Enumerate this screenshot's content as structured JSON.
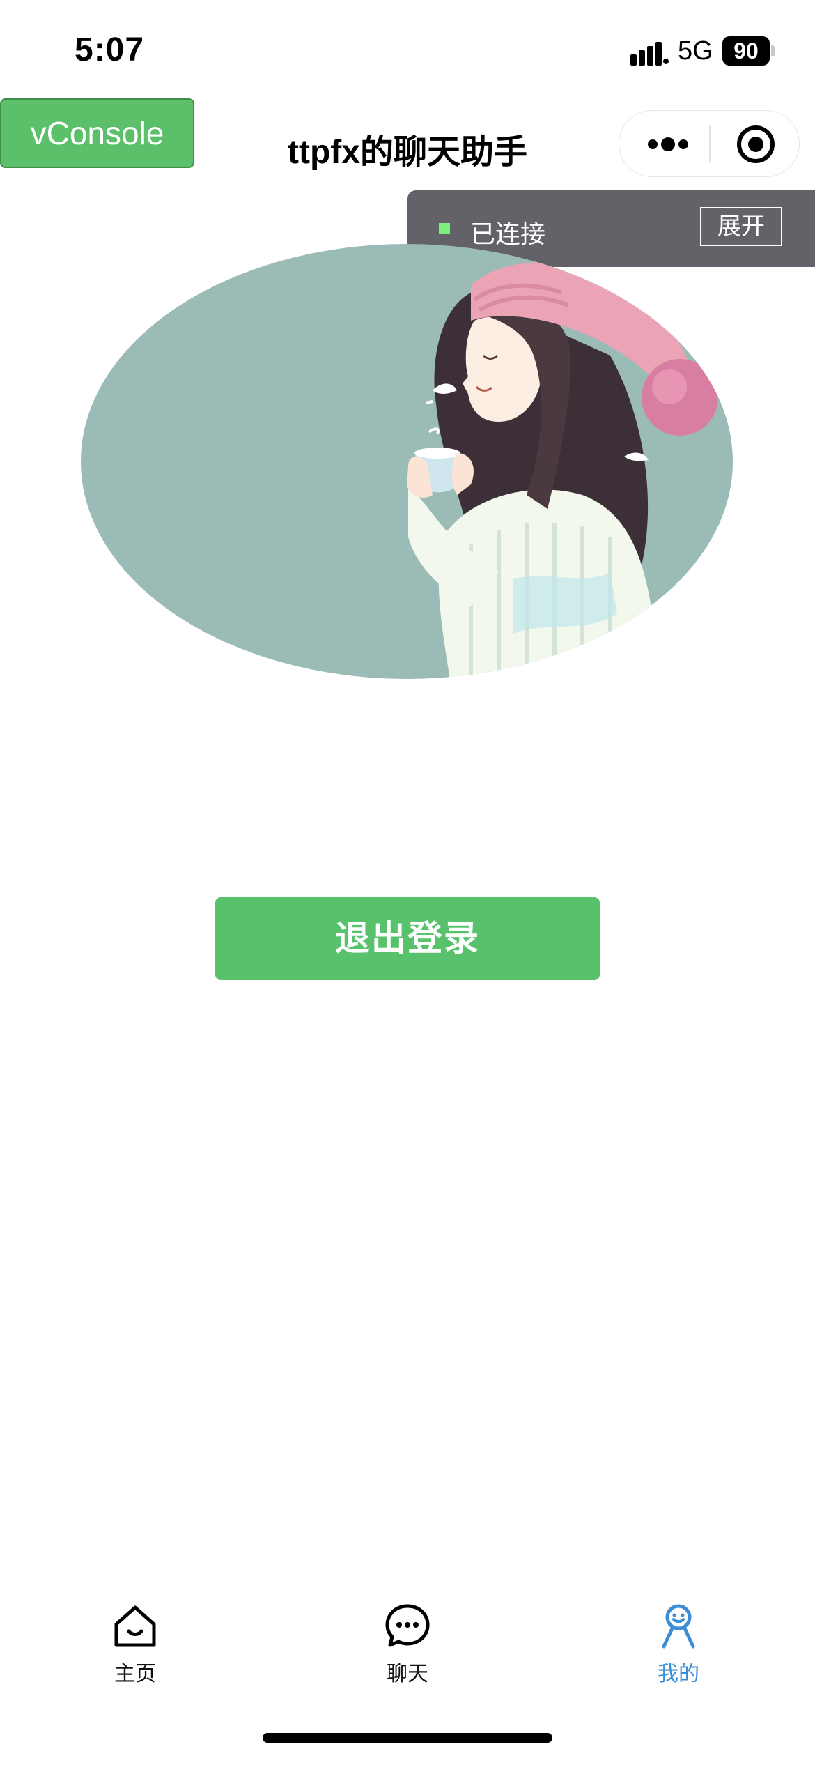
{
  "status_bar": {
    "time": "5:07",
    "network": "5G",
    "battery": "90"
  },
  "nav": {
    "vconsole_label": "vConsole",
    "title": "ttpfx的聊天助手"
  },
  "connection": {
    "status": "已连接",
    "expand_label": "展开",
    "status_color": "#7cf07c"
  },
  "profile": {
    "logout_label": "退出登录"
  },
  "tabbar": {
    "active_color": "#3b8ed6",
    "items": [
      {
        "label": "主页",
        "icon": "home-icon"
      },
      {
        "label": "聊天",
        "icon": "chat-icon"
      },
      {
        "label": "我的",
        "icon": "person-icon"
      }
    ]
  },
  "colors": {
    "accent_green": "#57c26b",
    "avatar_bg": "#9bbbb6"
  }
}
